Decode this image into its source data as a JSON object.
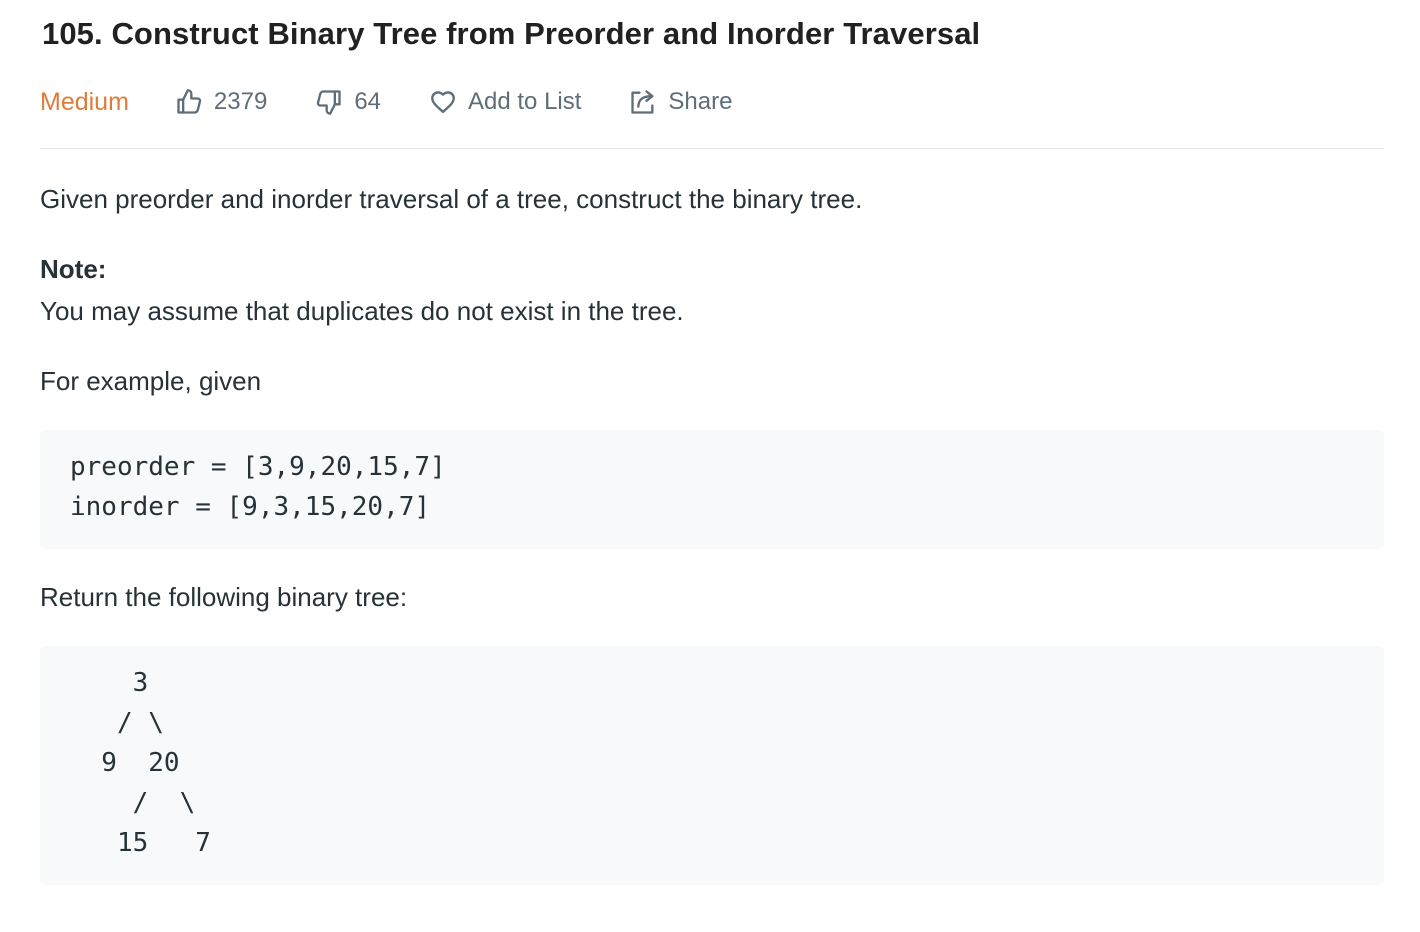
{
  "problem": {
    "title": "105. Construct Binary Tree from Preorder and Inorder Traversal",
    "difficulty": "Medium",
    "likes": "2379",
    "dislikes": "64",
    "add_to_list_label": "Add to List",
    "share_label": "Share"
  },
  "description": {
    "intro": "Given preorder and inorder traversal of a tree, construct the binary tree.",
    "note_label": "Note:",
    "note_text": "You may assume that duplicates do not exist in the tree.",
    "example_intro": "For example, given",
    "example_input": [
      "preorder = [3,9,20,15,7]",
      "inorder = [9,3,15,20,7]"
    ],
    "return_text": "Return the following binary tree:",
    "tree_lines": [
      "    3",
      "   / \\",
      "  9  20",
      "    /  \\",
      "   15   7"
    ]
  },
  "colors": {
    "difficulty_medium": "#e07c3b",
    "meta_text": "#5f6d78",
    "code_background": "#f7f9fa"
  },
  "icons": {
    "likes": "thumbs-up-icon",
    "dislikes": "thumbs-down-icon",
    "add_to_list": "heart-icon",
    "share": "share-icon"
  }
}
